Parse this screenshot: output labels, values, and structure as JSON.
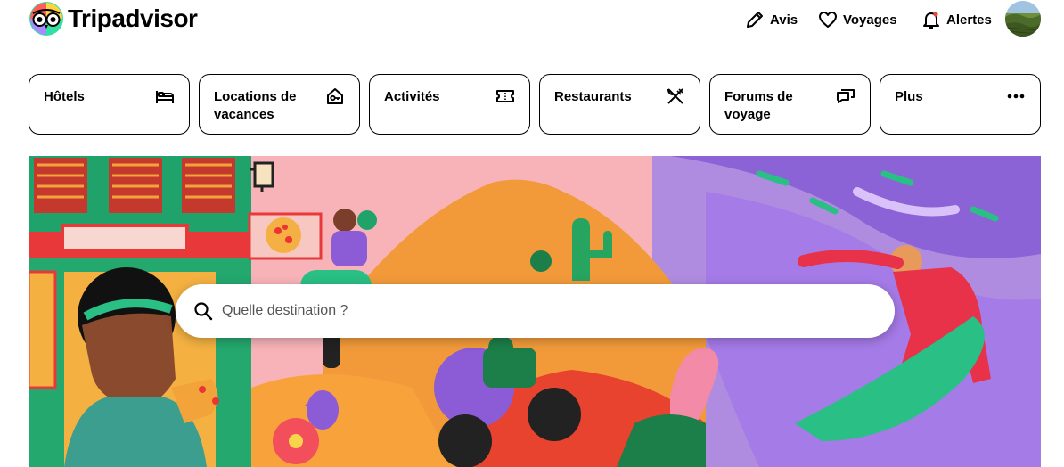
{
  "header": {
    "logo_text": "Tripadvisor",
    "nav": {
      "reviews": "Avis",
      "trips": "Voyages",
      "alerts": "Alertes"
    }
  },
  "categories": [
    {
      "label": "Hôtels",
      "icon": "bed-icon"
    },
    {
      "label": "Locations de vacances",
      "icon": "house-key-icon"
    },
    {
      "label": "Activités",
      "icon": "ticket-icon"
    },
    {
      "label": "Restaurants",
      "icon": "fork-knife-icon"
    },
    {
      "label": "Forums de voyage",
      "icon": "chat-bubbles-icon"
    },
    {
      "label": "Plus",
      "icon": "more-dots-icon"
    }
  ],
  "search": {
    "placeholder": "Quelle destination ?"
  },
  "colors": {
    "brand_green": "#34E0A1",
    "text": "#000000",
    "border": "#000000"
  }
}
